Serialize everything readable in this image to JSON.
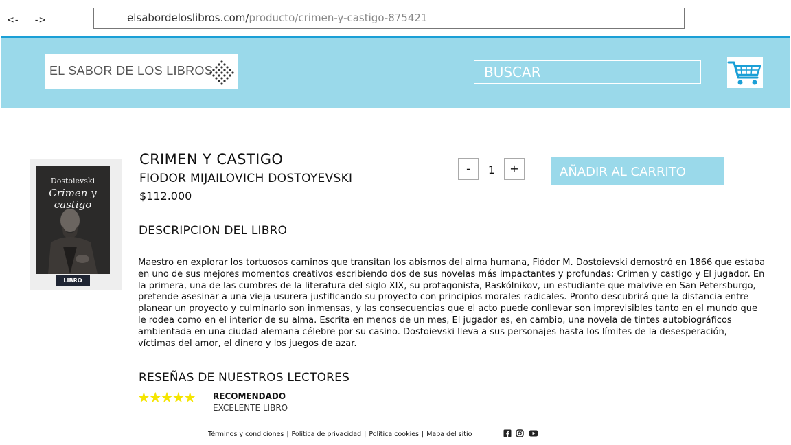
{
  "browser": {
    "back": "<-",
    "forward": "->",
    "url_domain": "elsabordeloslibros.com/",
    "url_path": "producto/crimen-y-castigo-875421"
  },
  "header": {
    "logo_text": "EL SABOR DE LOS LIBROS",
    "search_label": "BUSCAR",
    "accent_color": "#9ad9ea",
    "top_line_color": "#1a9fd6"
  },
  "product": {
    "title": "CRIMEN Y CASTIGO",
    "author": "FIODOR MIJAILOVICH DOSTOYEVSKI",
    "price": "$112.000",
    "cover_author": "Dostoievski",
    "cover_title": "Crimen y castigo",
    "cover_tag": "LIBRO",
    "quantity": "1",
    "minus_label": "-",
    "plus_label": "+",
    "add_to_cart": "AÑADIR AL CARRITO"
  },
  "description": {
    "heading": "DESCRIPCION DEL LIBRO",
    "text": "Maestro en explorar los tortuosos caminos que transitan los abismos del alma humana, Fiódor M. Dostoievski demostró en 1866 que estaba en uno de sus mejores momentos creativos escribiendo dos de sus novelas más impactantes y profundas: Crimen y castigo y El jugador. En la primera, una de las cumbres de la literatura del siglo XIX, su protagonista, Raskólnikov, un estudiante que malvive en San Petersburgo, pretende asesinar a una vieja usurera justificando su proyecto con principios morales radicales. Pronto descubrirá que la distancia entre planear un proyecto y culminarlo son inmensas, y las consecuencias que el acto puede conllevar son imprevisibles tanto en el mundo que le rodea como en el interior de su alma. Escrita en menos de un mes, El jugador es, en cambio, una novela de tintes autobiográficos ambientada en una ciudad alemana célebre por su casino. Dostoievski lleva a sus personajes hasta los límites de la desesperación, víctimas del amor, el dinero y los juegos de azar."
  },
  "reviews": {
    "heading": "RESEÑAS DE NUESTROS LECTORES",
    "items": [
      {
        "stars": 5,
        "stars_text": "★★★★★",
        "title": "RECOMENDADO",
        "text": "EXCELENTE LIBRO"
      }
    ]
  },
  "footer": {
    "links": [
      "Términos y condiciones",
      "Política de privacidad",
      "Política cookies",
      "Mapa del sitio"
    ],
    "separator": "|",
    "social_icons": [
      "facebook-icon",
      "instagram-icon",
      "youtube-icon"
    ]
  }
}
